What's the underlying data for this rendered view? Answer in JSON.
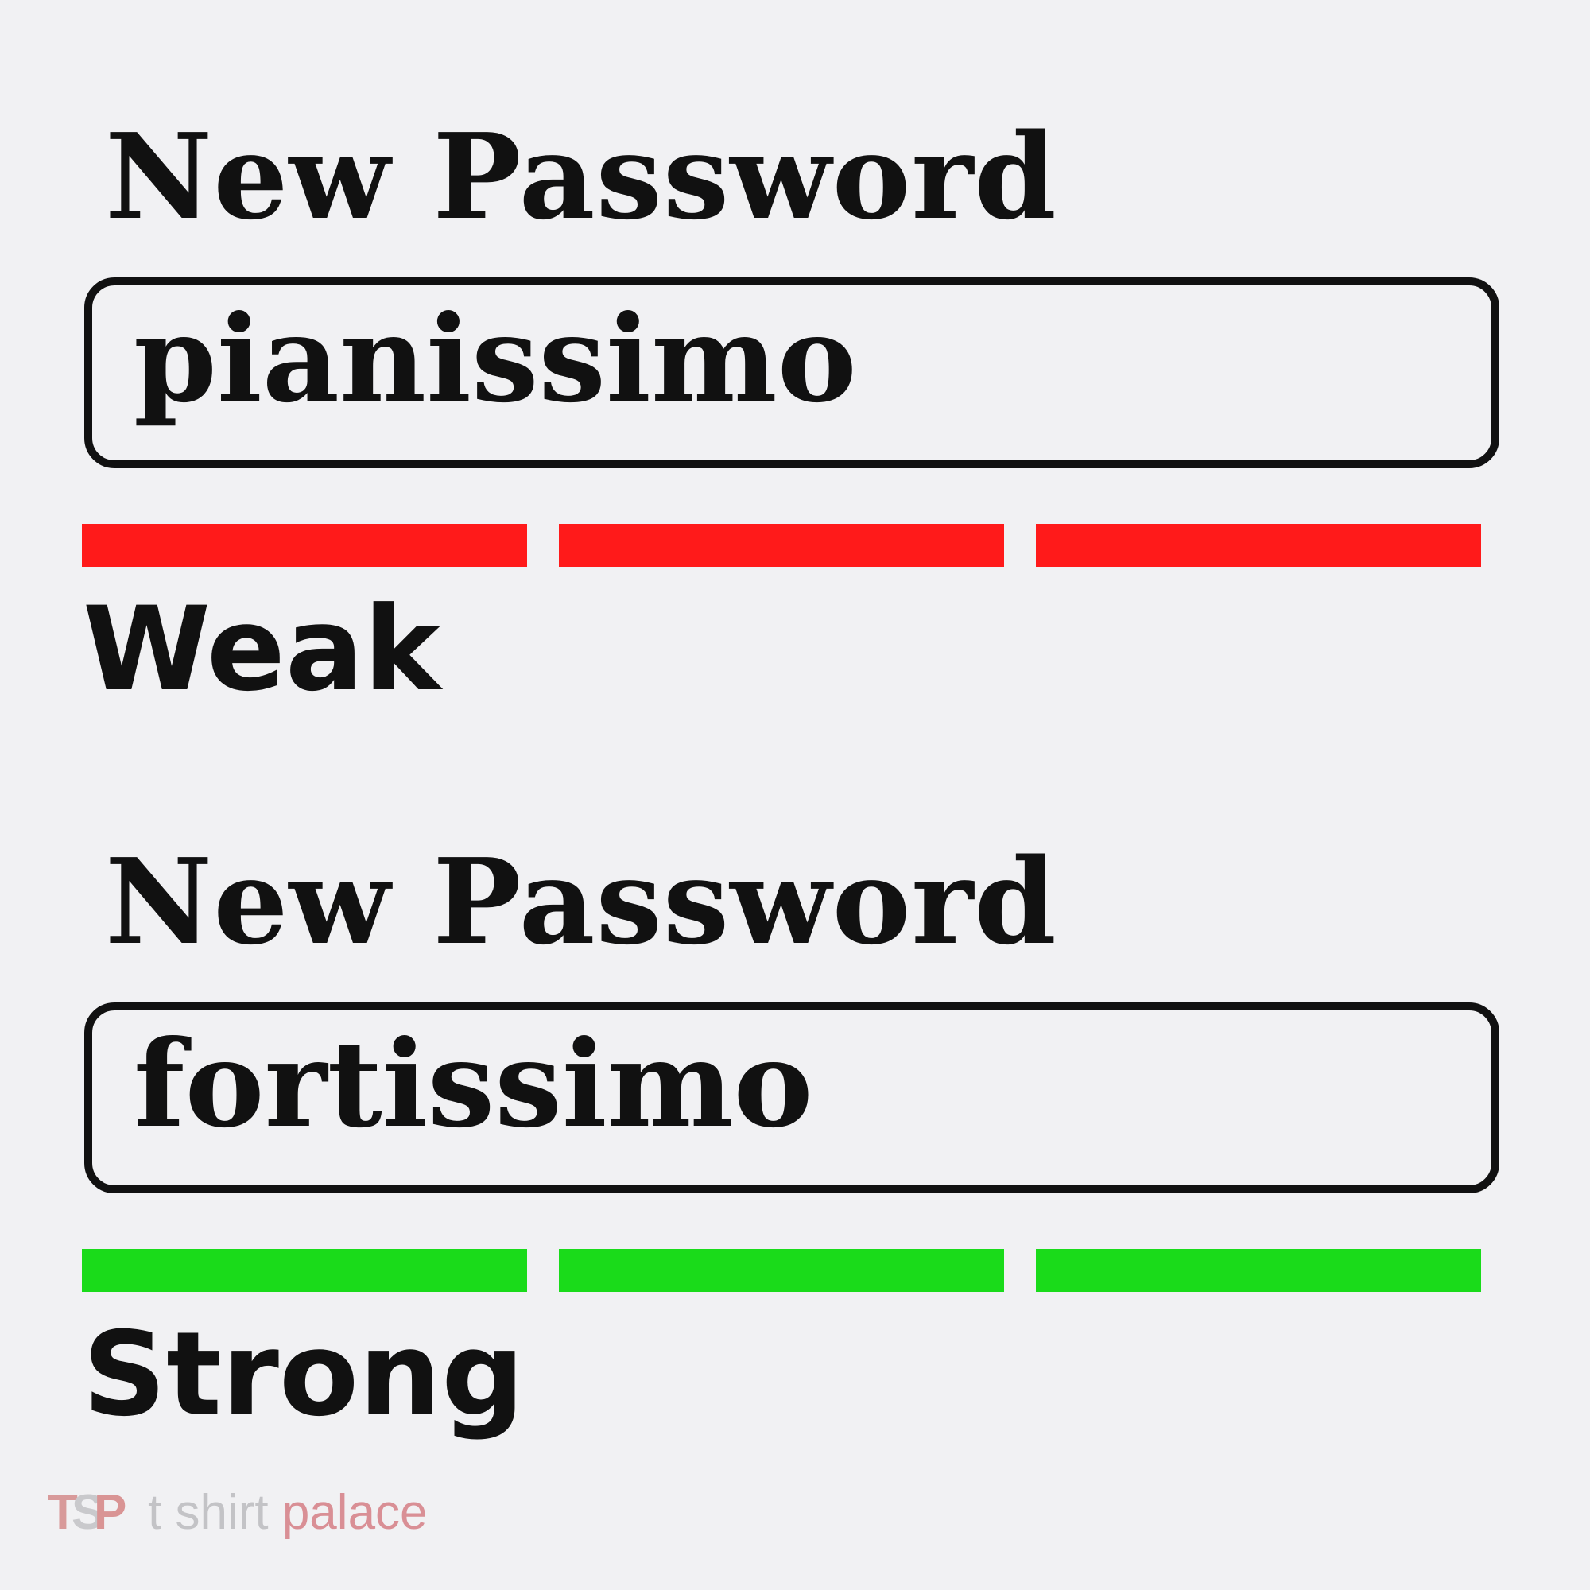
{
  "examples": [
    {
      "label": "New Password",
      "value": "pianissimo",
      "strength": "Weak",
      "meter_color": "#ff1a1a",
      "meter_segments_filled": 3,
      "meter_segments_total": 3
    },
    {
      "label": "New Password",
      "value": "fortissimo",
      "strength": "Strong",
      "meter_color": "#1adb1a",
      "meter_segments_filled": 3,
      "meter_segments_total": 3
    }
  ],
  "watermark": {
    "logo_letters": [
      "T",
      "S",
      "P"
    ],
    "text_part1": "t shirt",
    "text_part2": "palace",
    "colors": {
      "accent": "#d98f95",
      "muted": "#c3c3c6"
    }
  }
}
